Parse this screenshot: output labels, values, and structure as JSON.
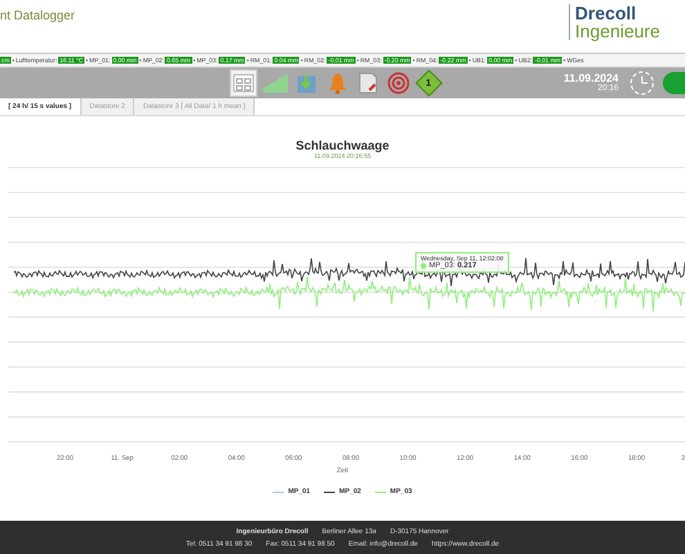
{
  "header": {
    "title": "nt Datalogger",
    "logo": [
      "Drecoll",
      "Ingenieure"
    ]
  },
  "ticker": [
    {
      "value": "cm"
    },
    {
      "sep": "•",
      "label": "Lufttemperatur:",
      "value": "16.11 °C"
    },
    {
      "sep": "•",
      "label": "MP_01:",
      "value": "0.00 mm"
    },
    {
      "sep": "•",
      "label": "MP_02:",
      "value": "0.65 mm"
    },
    {
      "sep": "•",
      "label": "MP_03:",
      "value": "0.17 mm"
    },
    {
      "sep": "•",
      "label": "RM_01:",
      "value": "0.04 mm"
    },
    {
      "sep": "•",
      "label": "RM_02:",
      "value": "-0.01 mm"
    },
    {
      "sep": "•",
      "label": "RM_03:",
      "value": "-0.20 mm"
    },
    {
      "sep": "•",
      "label": "RM_04:",
      "value": "-0.22 mm"
    },
    {
      "sep": "•",
      "label": "UB1:",
      "value": "0.00 mm"
    },
    {
      "sep": "•",
      "label": "UB2:",
      "value": "-0.01 mm"
    },
    {
      "sep": "•",
      "label": "WGes"
    }
  ],
  "toolbar": {
    "tools": [
      {
        "kind": "grid",
        "selected": true
      },
      {
        "kind": "area",
        "selected": false
      },
      {
        "kind": "download",
        "selected": false
      },
      {
        "kind": "bell",
        "selected": false
      },
      {
        "kind": "document",
        "selected": false
      },
      {
        "kind": "target",
        "selected": false
      },
      {
        "kind": "diamond",
        "selected": false,
        "text": "1"
      }
    ],
    "date": "11.09.2024",
    "time": "20:16",
    "toggle_on": true
  },
  "tabs": [
    {
      "label": "[ 24 h/ 15 s values ]",
      "selected": true
    },
    {
      "label": "Datastore 2",
      "selected": false
    },
    {
      "label": "Datastore 3 [ All Data/ 1 h mean ]",
      "selected": false
    }
  ],
  "chart": {
    "title": "Schlauchwaage",
    "subtitle": "11.09.2024 20:16:55",
    "xticks": [
      "22:00",
      "11. Sep",
      "02:00",
      "04:00",
      "06:00",
      "08:00",
      "10:00",
      "12:00",
      "14:00",
      "16:00",
      "18:00",
      "2"
    ],
    "xlabel": "Zeit",
    "tooltip": {
      "heading": "Wednesday, Sep 11, 12:02:08",
      "series": "MP_03:",
      "value": "0.217",
      "color": "#90ee7e"
    },
    "legend": [
      {
        "name": "MP_01",
        "color": "#a8c8e0"
      },
      {
        "name": "MP_02",
        "color": "#434348"
      },
      {
        "name": "MP_03",
        "color": "#90ee7e"
      }
    ]
  },
  "footer": {
    "lines": [
      [
        "**Ingenieurbüro Drecoll**",
        "Berliner Allee 13a",
        "D-30175 Hannover"
      ],
      [
        "Tel: 0511 34 91 98 30",
        "Fax: 0511 34 91 98 50",
        "Email: info@drecoll.de",
        "https://www.drecoll.de"
      ]
    ]
  }
}
